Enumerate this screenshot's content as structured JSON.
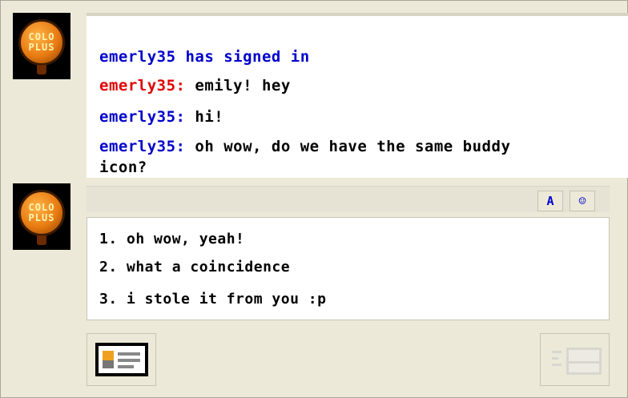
{
  "chat_log": {
    "system_line": "emerly35 has signed in",
    "messages": [
      {
        "nick": "emerly35:",
        "nick_color": "#e00000",
        "text": " emily! hey"
      },
      {
        "nick": "emerly35:",
        "nick_color": "#0000cc",
        "text": " hi!"
      },
      {
        "nick": "emerly35:",
        "nick_color": "#0000cc",
        "text": " oh wow, do we have the same buddy",
        "cont": "icon?"
      }
    ]
  },
  "avatars": {
    "top_text": [
      "COLO",
      "PLUS"
    ],
    "bottom_text": [
      "COLO",
      "PLUS"
    ]
  },
  "toolbar": {
    "font_btn": "A",
    "face_btn": "☺"
  },
  "input": {
    "options": [
      "1. oh wow, yeah!",
      "2. what a coincidence",
      "3. i stole it from you :p"
    ]
  },
  "icons": {
    "profile": "profile-card-icon",
    "mail": "mail-icon"
  }
}
